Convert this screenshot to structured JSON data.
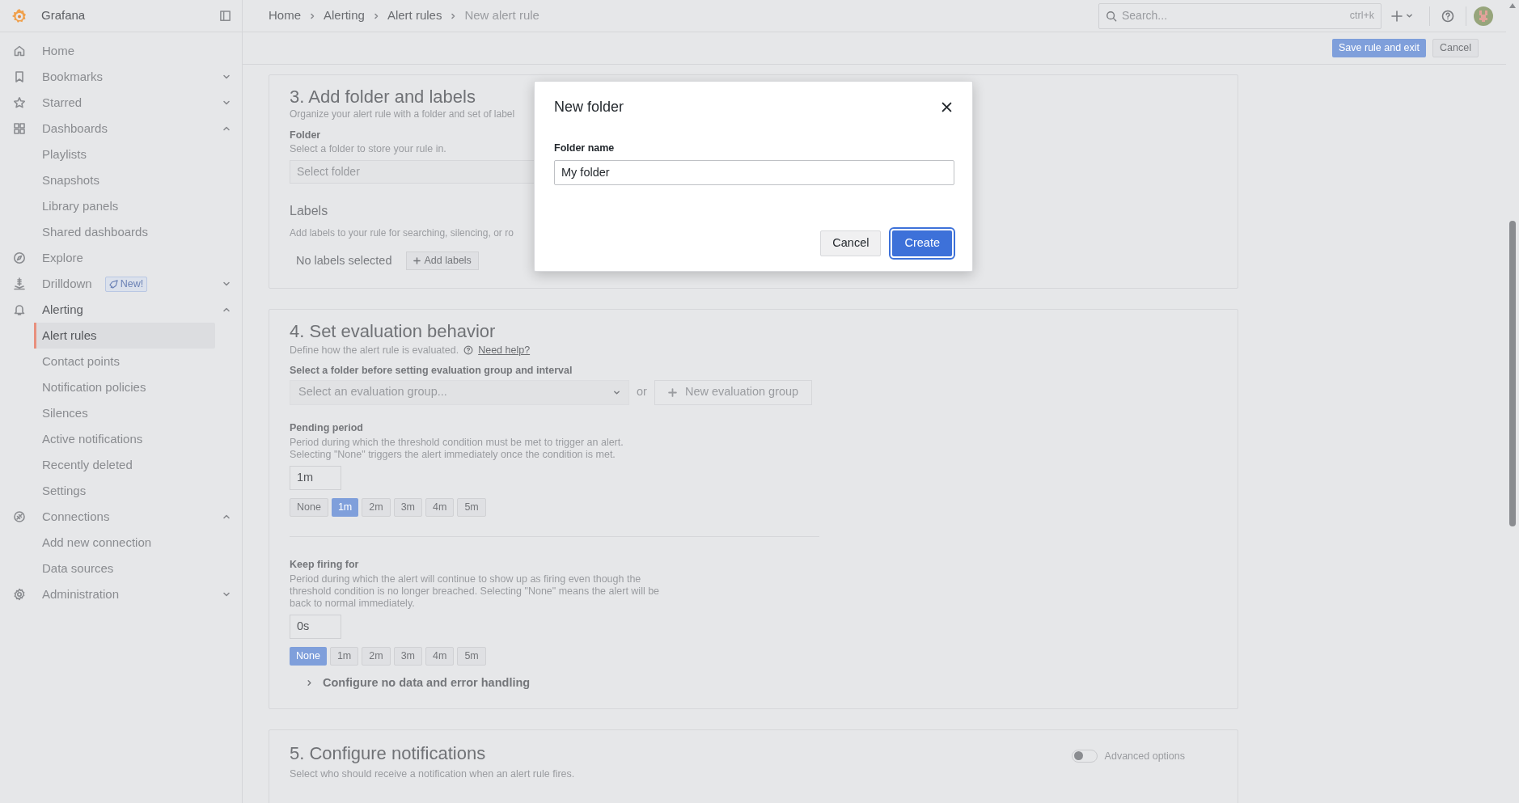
{
  "sidebar": {
    "brand": "Grafana",
    "items": [
      {
        "label": "Home"
      },
      {
        "label": "Bookmarks",
        "expanded": false
      },
      {
        "label": "Starred",
        "expanded": false
      },
      {
        "label": "Dashboards",
        "expanded": true,
        "children": [
          {
            "label": "Playlists",
            "selected": false
          },
          {
            "label": "Snapshots",
            "selected": false
          },
          {
            "label": "Library panels",
            "selected": false
          },
          {
            "label": "Shared dashboards",
            "selected": false
          }
        ]
      },
      {
        "label": "Explore"
      },
      {
        "label": "Drilldown",
        "expanded": false,
        "badge": "New!"
      },
      {
        "label": "Alerting",
        "expanded": true,
        "children": [
          {
            "label": "Alert rules",
            "selected": true
          },
          {
            "label": "Contact points",
            "selected": false
          },
          {
            "label": "Notification policies",
            "selected": false
          },
          {
            "label": "Silences",
            "selected": false
          },
          {
            "label": "Active notifications",
            "selected": false
          },
          {
            "label": "Recently deleted",
            "selected": false
          },
          {
            "label": "Settings",
            "selected": false
          }
        ]
      },
      {
        "label": "Connections",
        "expanded": true,
        "children": [
          {
            "label": "Add new connection",
            "selected": false
          },
          {
            "label": "Data sources",
            "selected": false
          }
        ]
      },
      {
        "label": "Administration",
        "expanded": false
      }
    ]
  },
  "breadcrumbs": [
    "Home",
    "Alerting",
    "Alert rules",
    "New alert rule"
  ],
  "search": {
    "placeholder": "Search...",
    "shortcut": "ctrl+k"
  },
  "toolbar": {
    "buttons": [
      {
        "label": "Save rule and exit",
        "kind": "primary"
      },
      {
        "label": "Cancel",
        "kind": "secondary"
      }
    ]
  },
  "section_3": {
    "title": "3. Add folder and labels",
    "description": "Organize your alert rule with a folder and set of label",
    "folder": {
      "label": "Folder",
      "description": "Select a folder to store your rule in.",
      "placeholder": "Select folder"
    },
    "labels": {
      "title": "Labels",
      "description": "Add labels to your rule for searching, silencing, or ro",
      "empty_text": "No labels selected",
      "button": "Add labels"
    }
  },
  "section_4": {
    "title": "4. Set evaluation behavior",
    "description": "Define how the alert rule is evaluated.",
    "help_link": "Need help?",
    "group_label": "Select a folder before setting evaluation group and interval",
    "group_placeholder": "Select an evaluation group...",
    "or": "or",
    "new_group_button": "New evaluation group",
    "periods": [
      {
        "label": "Pending period",
        "description": "Period during which the threshold condition must be met to trigger an alert. Selecting \"None\" triggers the alert immediately once the condition is met.",
        "value": "1m",
        "options": [
          {
            "label": "None",
            "selected": false
          },
          {
            "label": "1m",
            "selected": true
          },
          {
            "label": "2m",
            "selected": false
          },
          {
            "label": "3m",
            "selected": false
          },
          {
            "label": "4m",
            "selected": false
          },
          {
            "label": "5m",
            "selected": false
          }
        ]
      },
      {
        "label": "Keep firing for",
        "description": "Period during which the alert will continue to show up as firing even though the threshold condition is no longer breached. Selecting \"None\" means the alert will be back to normal immediately.",
        "value": "0s",
        "options": [
          {
            "label": "None",
            "selected": true
          },
          {
            "label": "1m",
            "selected": false
          },
          {
            "label": "2m",
            "selected": false
          },
          {
            "label": "3m",
            "selected": false
          },
          {
            "label": "4m",
            "selected": false
          },
          {
            "label": "5m",
            "selected": false
          }
        ]
      }
    ],
    "collapsible": {
      "label": "Configure no data and error handling",
      "expanded": false
    }
  },
  "section_5": {
    "title": "5. Configure notifications",
    "description": "Select who should receive a notification when an alert rule fires.",
    "toggle": {
      "label": "Advanced options",
      "on": false
    }
  },
  "modal": {
    "title": "New folder",
    "field_label": "Folder name",
    "value": "My folder",
    "buttons": [
      {
        "label": "Cancel",
        "kind": "secondary"
      },
      {
        "label": "Create",
        "kind": "primary"
      }
    ]
  }
}
